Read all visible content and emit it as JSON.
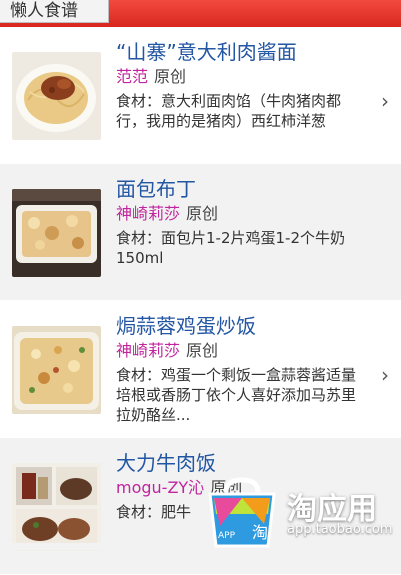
{
  "header": {
    "title": "懒人食谱"
  },
  "recipes": [
    {
      "name": "“山寨”意大利肉酱面",
      "author": "范范",
      "origin": "原创",
      "desc": "食材：意大利面肉馅（牛肉猪肉都行，我用的是猪肉）西红柿洋葱"
    },
    {
      "name": "面包布丁",
      "author": "神崎莉莎",
      "origin": "原创",
      "desc": "食材：面包片1-2片鸡蛋1-2个牛奶150ml"
    },
    {
      "name": "焗蒜蓉鸡蛋炒饭",
      "author": "神崎莉莎",
      "origin": "原创",
      "desc": "食材：鸡蛋一个剩饭一盒蒜蓉酱适量培根或香肠丁依个人喜好添加马苏里拉奶酪丝..."
    },
    {
      "name": "大力牛肉饭",
      "author": "mogu-ZY沁",
      "origin": "原创",
      "desc": "食材：肥牛"
    }
  ],
  "icons": {
    "chevron": "chevron-right-icon",
    "app": "taobao-bag-icon"
  },
  "brand": {
    "title": "淘应用",
    "url": "app.taobao.com"
  },
  "colors": {
    "header": "#e0322a",
    "title": "#2356a3",
    "author": "#c0249e",
    "alt_row": "#f2f2f2"
  }
}
